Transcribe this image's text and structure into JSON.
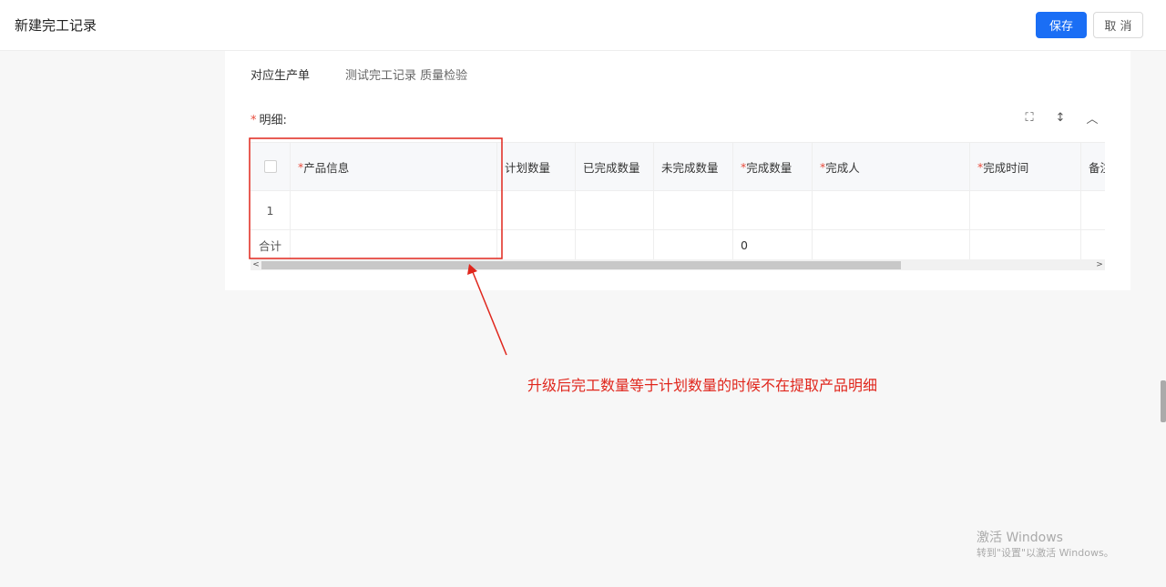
{
  "header": {
    "title": "新建完工记录",
    "save_label": "保存",
    "cancel_label": "取 消"
  },
  "form": {
    "production_order_label": "对应生产单",
    "production_order_value": "测试完工记录 质量检验"
  },
  "detail": {
    "label": "明细:",
    "required_mark": "*",
    "tools": [
      {
        "icon": "fullscreen-icon",
        "glyph": "⛶"
      },
      {
        "icon": "expand-vertical-icon",
        "glyph": "↕"
      },
      {
        "icon": "collapse-up-icon",
        "glyph": "︿"
      }
    ]
  },
  "table": {
    "columns": [
      {
        "label": "",
        "type": "checkbox"
      },
      {
        "label": "产品信息",
        "required": true
      },
      {
        "label": "计划数量",
        "required": false
      },
      {
        "label": "已完成数量",
        "required": false
      },
      {
        "label": "未完成数量",
        "required": false
      },
      {
        "label": "完成数量",
        "required": true
      },
      {
        "label": "完成人",
        "required": true
      },
      {
        "label": "完成时间",
        "required": true
      },
      {
        "label": "备注",
        "required": false
      }
    ],
    "rows": [
      {
        "index": "1",
        "cells": [
          "",
          "",
          "",
          "",
          "",
          "",
          "",
          ""
        ]
      }
    ],
    "summary": {
      "label": "合计",
      "cells": [
        "",
        "",
        "",
        "",
        "0",
        "",
        "",
        ""
      ]
    }
  },
  "scroll": {
    "left_arrow": "<",
    "right_arrow": ">"
  },
  "annotation": {
    "text": "升级后完工数量等于计划数量的时候不在提取产品明细",
    "color": "#e0261c"
  },
  "watermark": {
    "line1": "激活 Windows",
    "line2": "转到\"设置\"以激活 Windows。"
  },
  "colors": {
    "primary": "#1a6ef5",
    "required": "#e84b3c",
    "annotation": "#e0261c"
  }
}
